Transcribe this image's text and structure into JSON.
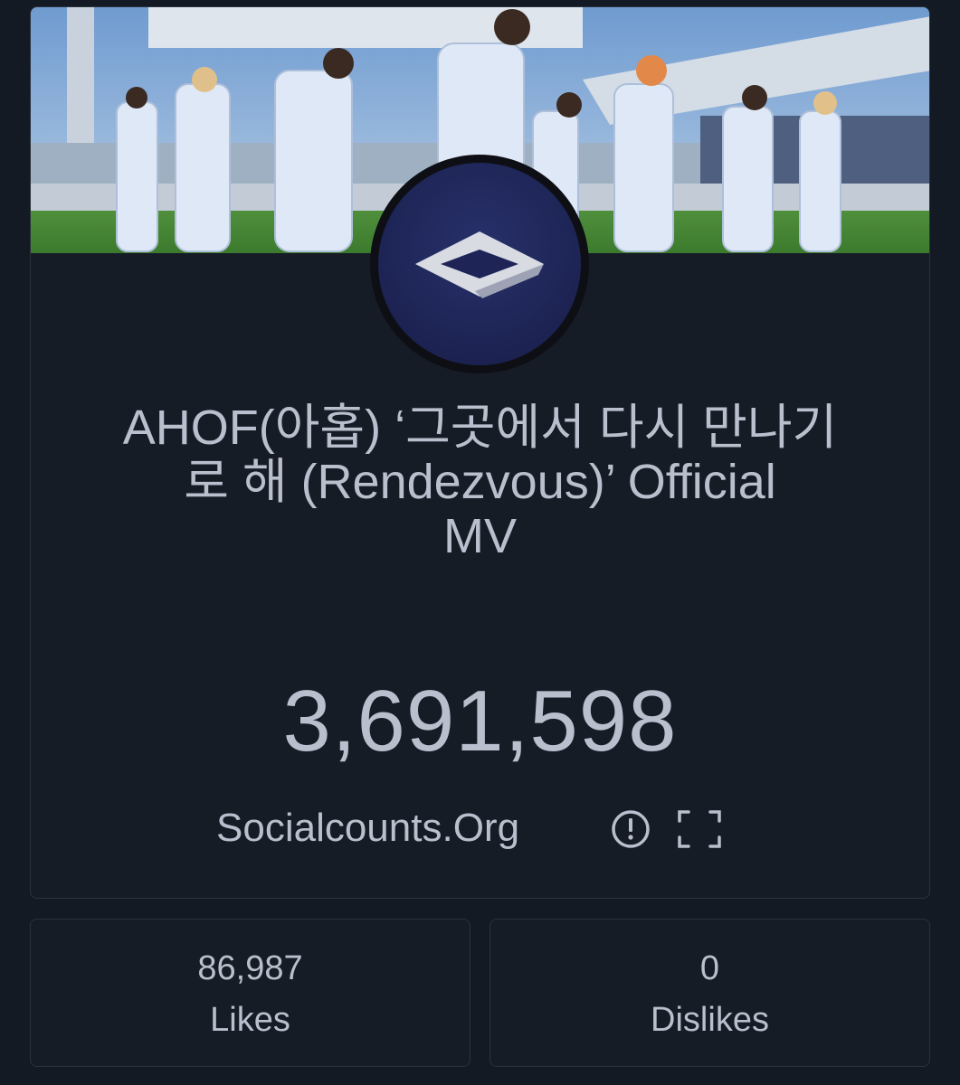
{
  "video": {
    "title_line1": "AHOF(아홉) ‘그곳에서 다시 만나기",
    "title_line2": "로 해 (Rendezvous)’ Official",
    "title_line3": "MV",
    "view_count": "3,691,598",
    "source": "Socialcounts.Org"
  },
  "stats": {
    "likes_value": "86,987",
    "likes_label": "Likes",
    "dislikes_value": "0",
    "dislikes_label": "Dislikes"
  },
  "icons": {
    "info": "info-circle-icon",
    "fullscreen": "fullscreen-icon",
    "channel_logo": "diamond-logo"
  },
  "colors": {
    "background": "#141a23",
    "card": "#161c26",
    "border": "#2b323d",
    "text": "#b9bfcc",
    "avatar": "#1e2556"
  }
}
